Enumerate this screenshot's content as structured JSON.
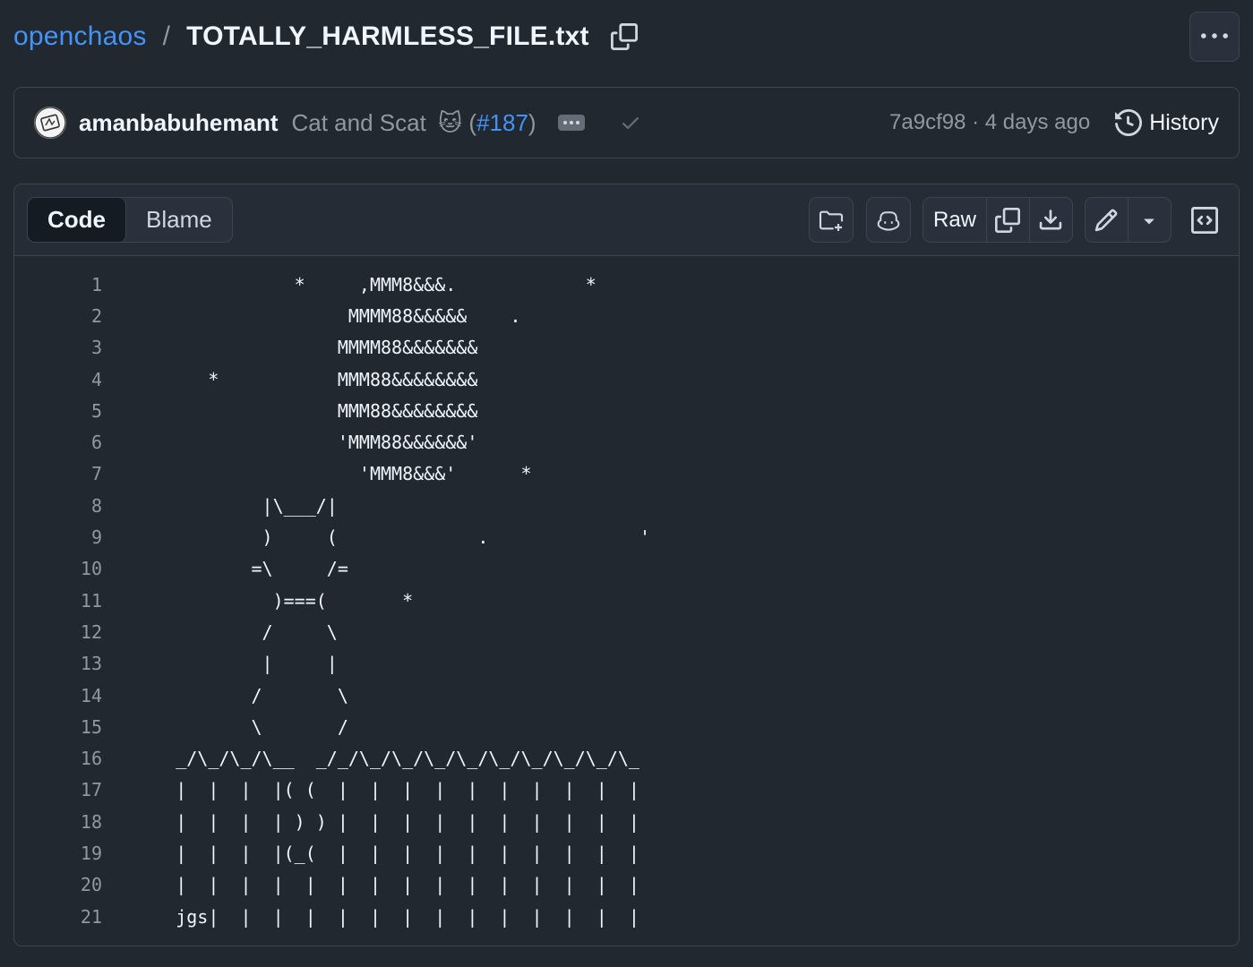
{
  "breadcrumb": {
    "repo": "openchaos",
    "separator": "/",
    "file": "TOTALLY_HARMLESS_FILE.txt"
  },
  "commit": {
    "author": "amanbabuhemant",
    "message": "Cat and Scat",
    "emoji": "🐱",
    "pr_open": "(",
    "pr_number": "#187",
    "pr_close": ")",
    "meta": "7a9cf98 · 4 days ago",
    "history_label": "History"
  },
  "viewer": {
    "tabs": [
      "Code",
      "Blame"
    ],
    "raw_label": "Raw"
  },
  "code_lines": [
    {
      "n": "1",
      "text": "                *     ,MMM8&&&.            *"
    },
    {
      "n": "2",
      "text": "                     MMMM88&&&&&    ."
    },
    {
      "n": "3",
      "text": "                    MMMM88&&&&&&&"
    },
    {
      "n": "4",
      "text": "        *           MMM88&&&&&&&&"
    },
    {
      "n": "5",
      "text": "                    MMM88&&&&&&&&"
    },
    {
      "n": "6",
      "text": "                    'MMM88&&&&&&'"
    },
    {
      "n": "7",
      "text": "                      'MMM8&&&'      *"
    },
    {
      "n": "8",
      "text": "             |\\___/|"
    },
    {
      "n": "9",
      "text": "             )     (             .              '"
    },
    {
      "n": "10",
      "text": "            =\\     /="
    },
    {
      "n": "11",
      "text": "              )===(       *"
    },
    {
      "n": "12",
      "text": "             /     \\"
    },
    {
      "n": "13",
      "text": "             |     |"
    },
    {
      "n": "14",
      "text": "            /       \\"
    },
    {
      "n": "15",
      "text": "            \\       /"
    },
    {
      "n": "16",
      "text": "     _/\\_/\\_/\\__  _/_/\\_/\\_/\\_/\\_/\\_/\\_/\\_/\\_/\\_"
    },
    {
      "n": "17",
      "text": "     |  |  |  |( (  |  |  |  |  |  |  |  |  |  |"
    },
    {
      "n": "18",
      "text": "     |  |  |  | ) ) |  |  |  |  |  |  |  |  |  |"
    },
    {
      "n": "19",
      "text": "     |  |  |  |(_(  |  |  |  |  |  |  |  |  |  |"
    },
    {
      "n": "20",
      "text": "     |  |  |  |  |  |  |  |  |  |  |  |  |  |  |"
    },
    {
      "n": "21",
      "text": "     jgs|  |  |  |  |  |  |  |  |  |  |  |  |  |"
    }
  ],
  "colors": {
    "background": "#212830",
    "link": "#4493f8",
    "border": "#3d444d",
    "muted_text": "#9198a1"
  }
}
